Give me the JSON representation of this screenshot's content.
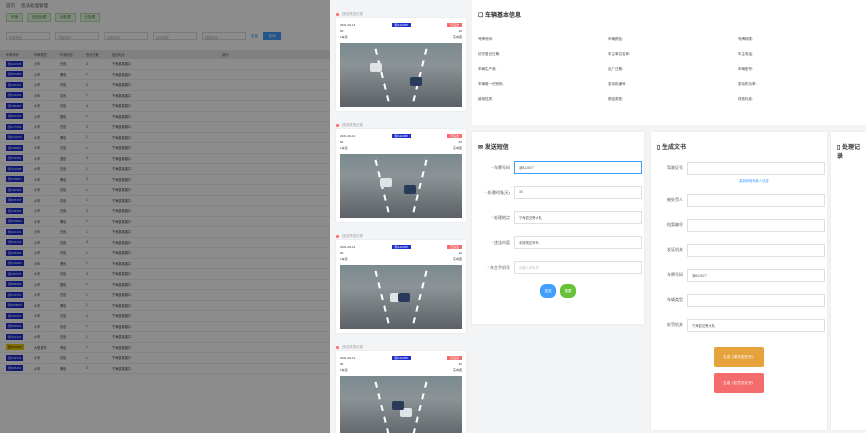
{
  "left": {
    "title": "违法处理管理",
    "home": "首页",
    "tabs": [
      "车辆",
      "违法处理",
      "待处理",
      "已处理"
    ],
    "filters": [
      "车牌号码",
      "开始时间",
      "结束时间",
      "违法类型",
      "处理状态"
    ],
    "search_label": "查询",
    "reset_link": "重置",
    "headers": [
      "车牌号码",
      "车辆类型",
      "车身颜色",
      "违法次数",
      "违法地点",
      "操作"
    ],
    "rows": [
      {
        "plate": "浙A12345",
        "type": "小车",
        "color": "白色",
        "cnt": "3",
        "addr": "宁海县某路口",
        "yellow": false
      },
      {
        "plate": "浙B67890",
        "type": "小车",
        "color": "黑色",
        "cnt": "1",
        "addr": "宁海县某路口",
        "yellow": false
      },
      {
        "plate": "浙A54321",
        "type": "小车",
        "color": "白色",
        "cnt": "2",
        "addr": "宁海县某路口",
        "yellow": false
      },
      {
        "plate": "浙C11223",
        "type": "小车",
        "color": "灰色",
        "cnt": "1",
        "addr": "宁海县某路口",
        "yellow": false
      },
      {
        "plate": "浙A88990",
        "type": "小车",
        "color": "白色",
        "cnt": "4",
        "addr": "宁海县某路口",
        "yellow": false
      },
      {
        "plate": "浙B22334",
        "type": "小车",
        "color": "银色",
        "cnt": "1",
        "addr": "宁海县某路口",
        "yellow": false
      },
      {
        "plate": "浙A77665",
        "type": "小车",
        "color": "白色",
        "cnt": "2",
        "addr": "宁海县某路口",
        "yellow": false
      },
      {
        "plate": "浙D33445",
        "type": "小车",
        "color": "黑色",
        "cnt": "1",
        "addr": "宁海县某路口",
        "yellow": false
      },
      {
        "plate": "浙A99887",
        "type": "小车",
        "color": "白色",
        "cnt": "1",
        "addr": "宁海县某路口",
        "yellow": false
      },
      {
        "plate": "浙B44556",
        "type": "小车",
        "color": "蓝色",
        "cnt": "3",
        "addr": "宁海县某路口",
        "yellow": false
      },
      {
        "plate": "浙A12098",
        "type": "小车",
        "color": "白色",
        "cnt": "1",
        "addr": "宁海县某路口",
        "yellow": false
      },
      {
        "plate": "浙C55667",
        "type": "小车",
        "color": "黑色",
        "cnt": "2",
        "addr": "宁海县某路口",
        "yellow": false
      },
      {
        "plate": "浙A30303",
        "type": "小车",
        "color": "白色",
        "cnt": "1",
        "addr": "宁海县某路口",
        "yellow": false
      },
      {
        "plate": "浙B78787",
        "type": "小车",
        "color": "灰色",
        "cnt": "1",
        "addr": "宁海县某路口",
        "yellow": false
      },
      {
        "plate": "浙A45454",
        "type": "小车",
        "color": "白色",
        "cnt": "2",
        "addr": "宁海县某路口",
        "yellow": false
      },
      {
        "plate": "浙D90909",
        "type": "小车",
        "color": "黑色",
        "cnt": "1",
        "addr": "宁海县某路口",
        "yellow": false
      },
      {
        "plate": "浙A13131",
        "type": "小车",
        "color": "白色",
        "cnt": "1",
        "addr": "宁海县某路口",
        "yellow": false
      },
      {
        "plate": "浙B24242",
        "type": "小车",
        "color": "红色",
        "cnt": "3",
        "addr": "宁海县某路口",
        "yellow": false
      },
      {
        "plate": "浙A35353",
        "type": "小车",
        "color": "白色",
        "cnt": "1",
        "addr": "宁海县某路口",
        "yellow": false
      },
      {
        "plate": "浙C46464",
        "type": "小车",
        "color": "黑色",
        "cnt": "1",
        "addr": "宁海县某路口",
        "yellow": false
      },
      {
        "plate": "浙A57575",
        "type": "小车",
        "color": "白色",
        "cnt": "2",
        "addr": "宁海县某路口",
        "yellow": false
      },
      {
        "plate": "浙B68686",
        "type": "小车",
        "color": "银色",
        "cnt": "1",
        "addr": "宁海县某路口",
        "yellow": false
      },
      {
        "plate": "浙A79797",
        "type": "小车",
        "color": "白色",
        "cnt": "1",
        "addr": "宁海县某路口",
        "yellow": false
      },
      {
        "plate": "浙D80808",
        "type": "小车",
        "color": "黑色",
        "cnt": "1",
        "addr": "宁海县某路口",
        "yellow": false
      },
      {
        "plate": "浙A91919",
        "type": "小车",
        "color": "白色",
        "cnt": "2",
        "addr": "宁海县某路口",
        "yellow": false
      },
      {
        "plate": "浙B02020",
        "type": "小车",
        "color": "灰色",
        "cnt": "1",
        "addr": "宁海县某路口",
        "yellow": false
      },
      {
        "plate": "浙A12121",
        "type": "小车",
        "color": "白色",
        "cnt": "1",
        "addr": "宁海县某路口",
        "yellow": false
      },
      {
        "plate": "浙C23232",
        "type": "大型货车",
        "color": "黄色",
        "cnt": "1",
        "addr": "宁海县某路口",
        "yellow": true
      },
      {
        "plate": "浙A34343",
        "type": "小车",
        "color": "白色",
        "cnt": "1",
        "addr": "宁海县某路口",
        "yellow": false
      },
      {
        "plate": "浙B45454",
        "type": "小车",
        "color": "黑色",
        "cnt": "2",
        "addr": "宁海县某路口",
        "yellow": false
      }
    ]
  },
  "captures": [
    {
      "title": "违法抓拍记录",
      "time": "2021-09-14",
      "plate": "浙A12345",
      "tag": "已违法",
      "speed": "60",
      "limit": "40",
      "lane": "1车道",
      "dir": "东向西"
    },
    {
      "title": "违法抓拍记录",
      "time": "2021-09-14",
      "plate": "浙A12345",
      "tag": "已违法",
      "speed": "60",
      "limit": "40",
      "lane": "1车道",
      "dir": "东向西"
    },
    {
      "title": "违法抓拍记录",
      "time": "2021-09-14",
      "plate": "浙A12345",
      "tag": "已违法",
      "speed": "60",
      "limit": "40",
      "lane": "1车道",
      "dir": "东向西"
    },
    {
      "title": "违法抓拍记录",
      "time": "2021-09-14",
      "plate": "浙A12345",
      "tag": "已违法",
      "speed": "60",
      "limit": "40",
      "lane": "1车道",
      "dir": "东向西"
    }
  ],
  "info": {
    "title": "车辆基本信息",
    "fields": [
      "号牌号码:",
      "车辆颜色:",
      "号牌种类:",
      "初次登记日期:",
      "车主单位名称:",
      "车主电话:",
      "车辆生产商:",
      "出厂日期:",
      "车辆型号:",
      "车辆唯一识别码:",
      "发动机编号:",
      "发动机功率:",
      "使用性质:",
      "燃油类型:",
      "排放标准:"
    ]
  },
  "sms": {
    "title": "发送短信",
    "fields": [
      {
        "label": "车牌号码",
        "value": "浙B2J6Y7",
        "focus": true,
        "ph": false
      },
      {
        "label": "处理时限(天)",
        "value": "30",
        "focus": false,
        "ph": false
      },
      {
        "label": "处理地点",
        "value": "宁海县交警大队",
        "focus": false,
        "ph": false
      },
      {
        "label": "违法内容",
        "value": "未按规定停车",
        "focus": false,
        "ph": false
      },
      {
        "label": "车主手机号",
        "value": "请输入手机号",
        "focus": false,
        "ph": true
      }
    ],
    "send_label": "发送",
    "reset_label": "重置"
  },
  "gen": {
    "title": "生成文书",
    "fields": [
      {
        "label": "驾驶证号",
        "value": ""
      },
      {
        "label": "被处罚人",
        "value": ""
      },
      {
        "label": "档案编号",
        "value": ""
      },
      {
        "label": "发证机关",
        "value": ""
      },
      {
        "label": "车牌号码",
        "value": "浙B2J6Y7"
      },
      {
        "label": "车辆类型",
        "value": ""
      },
      {
        "label": "处罚机关",
        "value": "宁海县交警大队"
      }
    ],
    "link": "重新获取驾驶人信息",
    "btn_notice": "生成《事先告知书》",
    "btn_decision": "生成《处罚决定书》"
  },
  "hist": {
    "title": "处理记录"
  }
}
